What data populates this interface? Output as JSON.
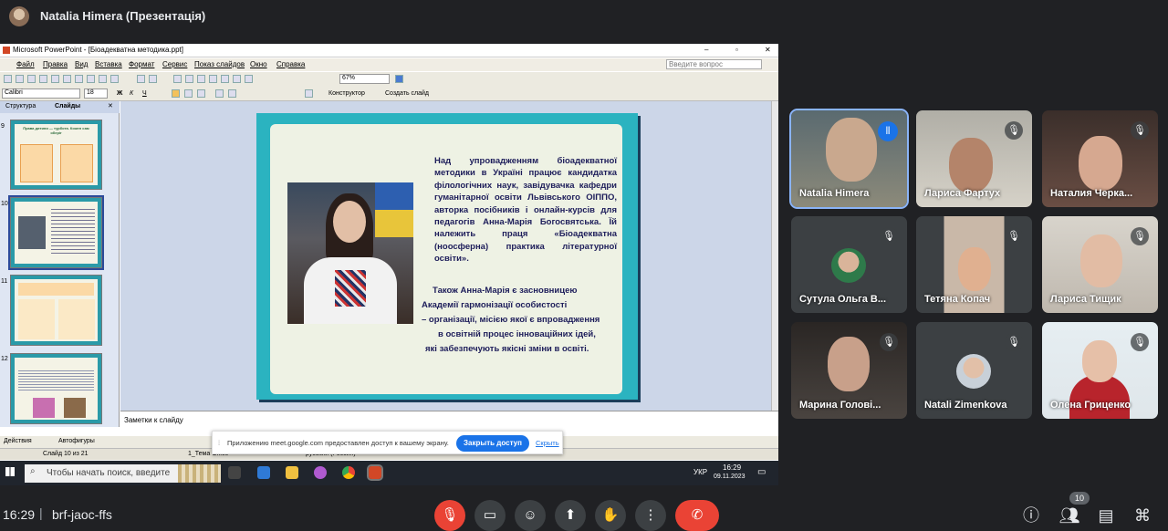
{
  "top": {
    "title": "Natalia Himera (Презентація)"
  },
  "ppt": {
    "window_title": "Microsoft PowerPoint - [Біоадекватна методика.ppt]",
    "menu": [
      "Файл",
      "Правка",
      "Вид",
      "Вставка",
      "Формат",
      "Сервис",
      "Показ слайдов",
      "Окно",
      "Справка"
    ],
    "help_placeholder": "Введите вопрос",
    "zoom": "67%",
    "font": "Calibri",
    "font_size": "18",
    "designer": "Конструктор",
    "new_slide": "Создать слайд",
    "tabs": [
      "Структура",
      "Слайды"
    ],
    "slide_numbers": [
      "9",
      "10",
      "11",
      "12"
    ],
    "thumb9_text": "Права дитини — турбота. Кожен сам оберіг",
    "notes_placeholder": "Заметки к слайду",
    "actions": "Действия",
    "autoshapes": "Автофигуры",
    "status_slide": "Слайд 10 из 21",
    "status_theme": "1_Тема Office",
    "status_lang": "русский (Россия)"
  },
  "slide": {
    "paragraph1": "Над упровадженням біоадекватної методики в Україні працює кандидатка філологічних наук, завідувачка кафедри гуманітарної освіти Львівського ОІППО, авторка посібників і онлайн-курсів для педагогів Анна-Марія Богосвятська. Їй належить праця «Біоадекватна (ноосферна) практика літературної освіти».",
    "line1": "Також Анна-Марія є засновницею",
    "line2": "Академії гармонізації особистості",
    "line3": "– організації, місією якої є впровадження",
    "line4": "в освітній процес інноваційних ідей,",
    "line5": "які забезпечують якісні зміни в освіті."
  },
  "share_banner": {
    "text": "Приложению meet.google.com предоставлен доступ к вашему экрану.",
    "stop_button": "Закрыть доступ",
    "hide_link": "Скрыть"
  },
  "taskbar": {
    "search_placeholder": "Чтобы начать поиск, введите",
    "lang": "УКР",
    "time": "16:29",
    "date": "09.11.2023"
  },
  "participants": [
    {
      "name": "Natalia Himera",
      "speaking": true
    },
    {
      "name": "Лариса Фартух",
      "muted": true
    },
    {
      "name": "Наталия Черка...",
      "muted": true
    },
    {
      "name": "Сутула Ольга В...",
      "muted": true
    },
    {
      "name": "Тетяна Копач",
      "muted": true
    },
    {
      "name": "Лариса Тищик",
      "muted": true
    },
    {
      "name": "Марина Голові...",
      "muted": true
    },
    {
      "name": "Natali Zimenkova",
      "muted": true
    },
    {
      "name": "Олена Гриценко",
      "muted": true
    }
  ],
  "bottom": {
    "time": "16:29",
    "separator": "|",
    "meeting_code": "brf-jaoc-ffs",
    "participant_count": "10"
  },
  "colors": {
    "end_call": "#ea4335",
    "mic_off": "#ea4335",
    "accent": "#1a73e8"
  }
}
